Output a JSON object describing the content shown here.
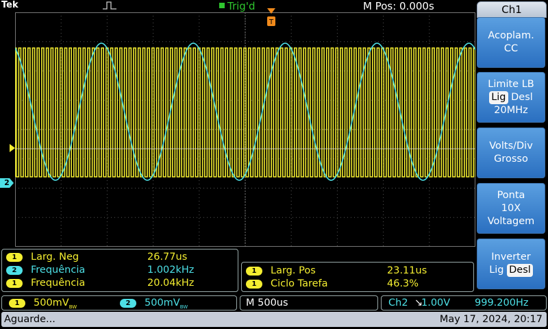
{
  "topbar": {
    "brand": "Tek",
    "trigger_status": "Trig'd",
    "position": "M Pos: 0.000s"
  },
  "side_menu": {
    "title": "Ch1",
    "buttons": [
      {
        "line1": "Acoplam.",
        "line2": "CC"
      },
      {
        "line1": "Limite LB",
        "opt_on": "Lig",
        "opt_off": "Desl",
        "line3": "20MHz"
      },
      {
        "line1": "Volts/Div",
        "line2": "Grosso"
      },
      {
        "line1": "Ponta",
        "line2": "10X",
        "line3": "Voltagem"
      },
      {
        "line1": "Inverter",
        "opt_a": "Lig",
        "opt_b": "Desl"
      }
    ]
  },
  "measurements_left": [
    {
      "channel": "1",
      "label": "Larg. Neg",
      "value": "26.77us"
    },
    {
      "channel": "2",
      "label": "Frequência",
      "value": "1.002kHz"
    },
    {
      "channel": "1",
      "label": "Frequência",
      "value": "20.04kHz"
    }
  ],
  "measurements_right": [
    {
      "channel": "1",
      "label": "Larg. Pos",
      "value": "23.11us"
    },
    {
      "channel": "1",
      "label": "Ciclo Tarefa",
      "value": "46.3%"
    }
  ],
  "channels": {
    "ch1": {
      "number": "1",
      "scale": "500mV",
      "bw": "BW"
    },
    "ch2": {
      "number": "2",
      "scale": "500mV",
      "bw": "BW"
    }
  },
  "timebase": "M 500us",
  "trigger": {
    "source": "Ch2",
    "slope": "↘",
    "level": "1.00V",
    "frequency": "999.200Hz"
  },
  "status": {
    "message": "Aguarde...",
    "datetime": "May 17, 2024, 20:17"
  },
  "colors": {
    "ch1": "#f4ee31",
    "ch2": "#4de0e6",
    "trigger": "#f08a1c",
    "status_green": "#2ec52e"
  },
  "waveforms": {
    "ch1_frequency_hz": 20040,
    "ch2_frequency_hz": 1002,
    "time_per_div_s": 0.0005
  }
}
